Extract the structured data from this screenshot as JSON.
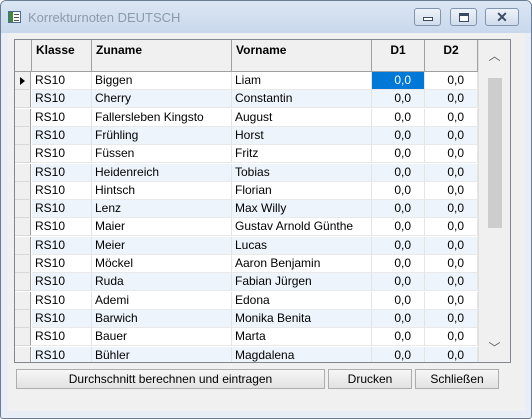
{
  "window": {
    "title": "Korrekturnoten DEUTSCH"
  },
  "grid": {
    "columns": [
      "Klasse",
      "Zuname",
      "Vorname",
      "D1",
      "D2"
    ],
    "rows": [
      {
        "klasse": "RS10",
        "zuname": "Biggen",
        "vorname": "Liam",
        "d1": "0,0",
        "d2": "0,0"
      },
      {
        "klasse": "RS10",
        "zuname": "Cherry",
        "vorname": "Constantin",
        "d1": "0,0",
        "d2": "0,0"
      },
      {
        "klasse": "RS10",
        "zuname": "Fallersleben Kingsto",
        "vorname": "August",
        "d1": "0,0",
        "d2": "0,0"
      },
      {
        "klasse": "RS10",
        "zuname": "Frühling",
        "vorname": "Horst",
        "d1": "0,0",
        "d2": "0,0"
      },
      {
        "klasse": "RS10",
        "zuname": "Füssen",
        "vorname": "Fritz",
        "d1": "0,0",
        "d2": "0,0"
      },
      {
        "klasse": "RS10",
        "zuname": "Heidenreich",
        "vorname": "Tobias",
        "d1": "0,0",
        "d2": "0,0"
      },
      {
        "klasse": "RS10",
        "zuname": "Hintsch",
        "vorname": "Florian",
        "d1": "0,0",
        "d2": "0,0"
      },
      {
        "klasse": "RS10",
        "zuname": "Lenz",
        "vorname": "Max Willy",
        "d1": "0,0",
        "d2": "0,0"
      },
      {
        "klasse": "RS10",
        "zuname": "Maier",
        "vorname": "Gustav Arnold Günthe",
        "d1": "0,0",
        "d2": "0,0"
      },
      {
        "klasse": "RS10",
        "zuname": "Meier",
        "vorname": "Lucas",
        "d1": "0,0",
        "d2": "0,0"
      },
      {
        "klasse": "RS10",
        "zuname": "Möckel",
        "vorname": "Aaron Benjamin",
        "d1": "0,0",
        "d2": "0,0"
      },
      {
        "klasse": "RS10",
        "zuname": "Ruda",
        "vorname": "Fabian Jürgen",
        "d1": "0,0",
        "d2": "0,0"
      },
      {
        "klasse": "RS10",
        "zuname": "Ademi",
        "vorname": "Edona",
        "d1": "0,0",
        "d2": "0,0"
      },
      {
        "klasse": "RS10",
        "zuname": "Barwich",
        "vorname": "Monika Benita",
        "d1": "0,0",
        "d2": "0,0"
      },
      {
        "klasse": "RS10",
        "zuname": "Bauer",
        "vorname": "Marta",
        "d1": "0,0",
        "d2": "0,0"
      },
      {
        "klasse": "RS10",
        "zuname": "Bühler",
        "vorname": "Magdalena",
        "d1": "0,0",
        "d2": "0,0"
      }
    ]
  },
  "buttons": {
    "calc": "Durchschnitt berechnen und eintragen",
    "print": "Drucken",
    "close": "Schließen"
  }
}
